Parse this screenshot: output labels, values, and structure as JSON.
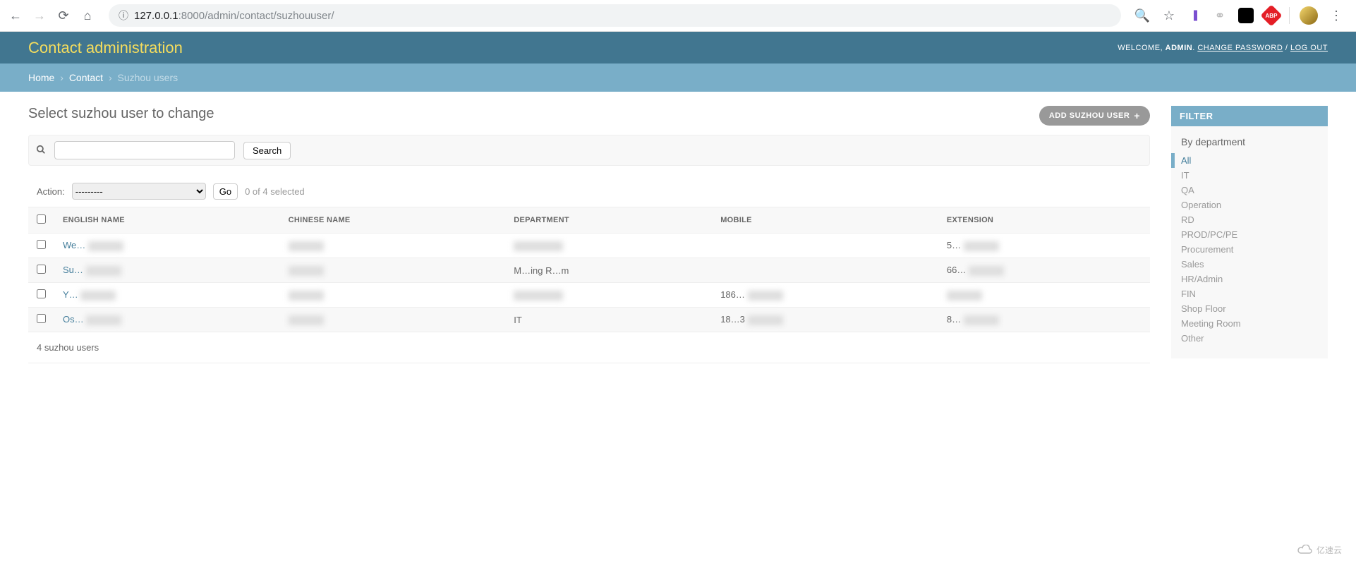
{
  "browser": {
    "url_info_icon": "ⓘ",
    "url_host_dark": "127.0.0.1",
    "url_host_dim": ":8000/admin/contact/suzhouuser/"
  },
  "header": {
    "title": "Contact administration",
    "welcome": "WELCOME, ",
    "user": "ADMIN",
    "dot": ". ",
    "change_pwd": "CHANGE PASSWORD",
    "sep": " / ",
    "logout": "LOG OUT"
  },
  "breadcrumbs": {
    "home": "Home",
    "contact": "Contact",
    "current": "Suzhou users",
    "sep": "›"
  },
  "page": {
    "title": "Select suzhou user to change",
    "add_button": "ADD SUZHOU USER",
    "search_button": "Search",
    "action_label": "Action:",
    "action_placeholder": "---------",
    "go_button": "Go",
    "selected_text": "0 of 4 selected",
    "row_count": "4 suzhou users"
  },
  "columns": {
    "english": "ENGLISH NAME",
    "chinese": "CHINESE NAME",
    "department": "DEPARTMENT",
    "mobile": "MOBILE",
    "extension": "EXTENSION"
  },
  "rows": [
    {
      "english": "We…",
      "chinese": "",
      "department": "",
      "mobile": "",
      "extension": "5…"
    },
    {
      "english": "Su…",
      "chinese": "",
      "department": "M…ing R…m",
      "mobile": "",
      "extension": "66…"
    },
    {
      "english": "Y…",
      "chinese": "",
      "department": "",
      "mobile": "186…",
      "extension": ""
    },
    {
      "english": "Os…",
      "chinese": "",
      "department": "IT",
      "mobile": "18…3",
      "extension": "8…"
    }
  ],
  "filter": {
    "title": "FILTER",
    "by": "By department",
    "items": [
      "All",
      "IT",
      "QA",
      "Operation",
      "RD",
      "PROD/PC/PE",
      "Procurement",
      "Sales",
      "HR/Admin",
      "FIN",
      "Shop Floor",
      "Meeting Room",
      "Other"
    ],
    "selected_index": 0
  },
  "watermark": "亿速云"
}
